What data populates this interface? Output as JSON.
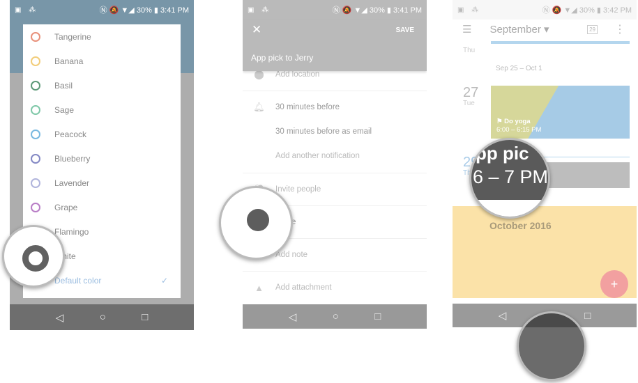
{
  "panel1": {
    "status": {
      "time": "3:41 PM",
      "battery": "30%"
    },
    "colors": [
      {
        "label": "Tangerine",
        "hex": "#e8907a"
      },
      {
        "label": "Banana",
        "hex": "#f2cd7a"
      },
      {
        "label": "Basil",
        "hex": "#5d9a78"
      },
      {
        "label": "Sage",
        "hex": "#7fc8a8"
      },
      {
        "label": "Peacock",
        "hex": "#79b9e0"
      },
      {
        "label": "Blueberry",
        "hex": "#8388c4"
      },
      {
        "label": "Lavender",
        "hex": "#b0b4dc"
      },
      {
        "label": "Grape",
        "hex": "#b87dc6"
      },
      {
        "label": "Flamingo",
        "hex": "#eba6a6"
      },
      {
        "label": "White",
        "hex": "#dddddd"
      }
    ],
    "default_label": "Default color",
    "check_icon": "checkmark-icon"
  },
  "panel2": {
    "status": {
      "time": "3:41 PM",
      "battery": "30%"
    },
    "close_icon": "close-icon",
    "save_label": "SAVE",
    "title": "App pick to Jerry",
    "location": "Add location",
    "notif1": "30 minutes before",
    "notif2": "30 minutes before as email",
    "add_notif": "Add another notification",
    "invite": "Invite people",
    "color": "White",
    "note": "Add note",
    "attachment": "Add attachment"
  },
  "panel3": {
    "status": {
      "time": "3:42 PM",
      "battery": "30%"
    },
    "month": "September",
    "today": "29",
    "thu": "Thu",
    "week": "Sep 25 – Oct 1",
    "day27": "27",
    "tue": "Tue",
    "event1_title": "Do yoga",
    "event1_time": "6:00 – 6:15 PM",
    "day29": "29",
    "thu2": "Thu",
    "mag_title": "pp pic",
    "mag_time": "6 – 7 PM",
    "october": "October 2016",
    "fab": "+"
  },
  "nav": {
    "back": "◁",
    "home": "○",
    "recent": "□"
  }
}
